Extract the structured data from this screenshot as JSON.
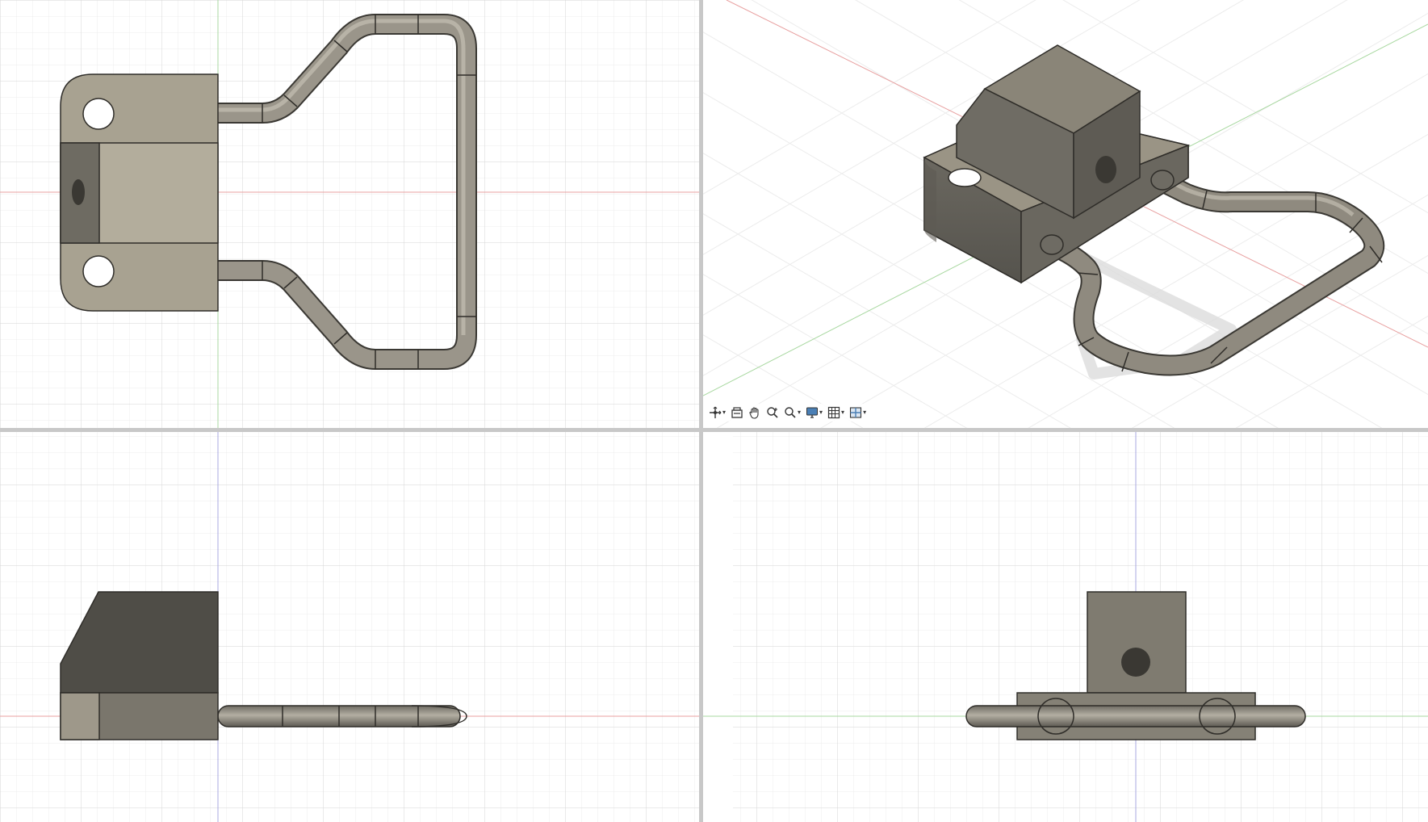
{
  "app": {
    "viewport_layout": "four-view",
    "views": [
      {
        "name": "top",
        "projection": "orthographic"
      },
      {
        "name": "home-3d",
        "projection": "isometric"
      },
      {
        "name": "front",
        "projection": "orthographic"
      },
      {
        "name": "right",
        "projection": "orthographic"
      }
    ]
  },
  "colors": {
    "background": "#ffffff",
    "grid_minor": "#ececec",
    "grid_major": "#d9d9d9",
    "axis_x": "#e8a0a0",
    "axis_y": "#a8d8a0",
    "axis_z": "#a8a8e0",
    "body_light": "#9e9888",
    "body_mid": "#807c70",
    "body_dark": "#5f5c54",
    "tube": "#8d897f",
    "divider": "#c8c8c8"
  },
  "toolbar": {
    "items": [
      {
        "icon": "orbit-icon",
        "has_menu": true
      },
      {
        "icon": "look-at-icon",
        "has_menu": false
      },
      {
        "icon": "pan-hand-icon",
        "has_menu": false
      },
      {
        "icon": "zoom-icon",
        "has_menu": false
      },
      {
        "icon": "fit-zoom-icon",
        "has_menu": true
      },
      {
        "icon": "display-settings-icon",
        "has_menu": true
      },
      {
        "icon": "grid-snap-icon",
        "has_menu": true
      },
      {
        "icon": "viewports-icon",
        "has_menu": true
      }
    ]
  }
}
